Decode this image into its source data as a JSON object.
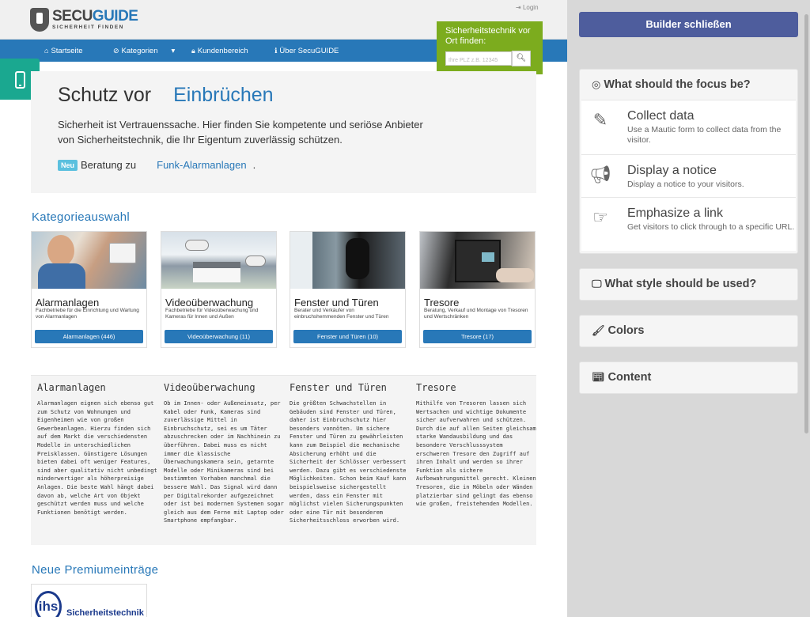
{
  "site": {
    "logo_main_1": "SECU",
    "logo_main_2": "GUIDE",
    "logo_sub": "SICHERHEIT FINDEN",
    "login": "Login",
    "nav": [
      "Startseite",
      "Kategorien",
      "Kundenbereich",
      "Über SecuGUIDE"
    ],
    "finder": {
      "title": "Sicherheitstechnik vor Ort finden:",
      "placeholder": "Ihre PLZ z.B. 12345"
    },
    "hero": {
      "title_1": "Schutz vor",
      "title_2": "Einbrüchen",
      "text": "Sicherheit ist Vertrauenssache. Hier finden Sie kompetente und seriöse Anbieter von Sicherheitstechnik, die Ihr Eigentum zuverlässig schützen.",
      "badge": "Neu",
      "news_prefix": "Beratung zu",
      "news_link": "Funk-Alarmanlagen",
      "news_suffix": "."
    },
    "category_heading": "Kategorieauswahl",
    "cards": [
      {
        "title": "Alarmanlagen",
        "desc": "Fachbetriebe für die Einrichtung und Wartung von Alarmanlagen",
        "button": "Alarmanlagen (446)"
      },
      {
        "title": "Videoüberwachung",
        "desc": "Fachbetriebe für Videoüberwachung und Kameras für Innen und Außen",
        "button": "Videoüberwachung (11)"
      },
      {
        "title": "Fenster und Türen",
        "desc": "Berater und Verkäufer von einbruchshemmenden Fenster und Türen",
        "button": "Fenster und Türen (10)"
      },
      {
        "title": "Tresore",
        "desc": "Beratung, Verkauf und Montage von Tresoren und Wertschränken",
        "button": "Tresore (17)"
      }
    ],
    "text_columns": [
      {
        "title": "Alarmanlagen",
        "body": "Alarmanlagen eignen sich ebenso gut zum Schutz von Wohnungen und Eigenheimen wie von großen Gewerbeanlagen. Hierzu finden sich auf dem Markt die verschiedensten Modelle in unterschiedlichen Preisklassen. Günstigere Lösungen bieten dabei oft weniger Features, sind aber qualitativ nicht unbedingt minderwertiger als höherpreisige Anlagen. Die beste Wahl hängt dabei davon ab, welche Art von Objekt geschützt werden muss und welche Funktionen benötigt werden."
      },
      {
        "title": "Videoüberwachung",
        "body": "Ob im Innen- oder Außeneinsatz, per Kabel oder Funk, Kameras sind zuverlässige Mittel in Einbruchschutz, sei es um Täter abzuschrecken oder im Nachhinein zu überführen. Dabei muss es nicht immer die klassische Überwachungskamera sein, getarnte Modelle oder Minikameras sind bei bestimmten Vorhaben manchmal die bessere Wahl. Das Signal wird dann per Digitalrekorder aufgezeichnet oder ist bei modernen Systemen sogar gleich aus dem Ferne mit Laptop oder Smartphone empfangbar."
      },
      {
        "title": "Fenster und Türen",
        "body": "Die größten Schwachstellen in Gebäuden sind Fenster und Türen, daher ist Einbruchschutz hier besonders vonnöten. Um sichere Fenster und Türen zu gewährleisten kann zum Beispiel die mechanische Absicherung erhöht und die Sicherheit der Schlösser verbessert werden. Dazu gibt es verschiedenste Möglichkeiten. Schon beim Kauf kann beispielsweise sichergestellt werden, dass ein Fenster mit möglichst vielen Sicherungspunkten oder eine Tür mit besonderem Sicherheitsschloss erworben wird."
      },
      {
        "title": "Tresore",
        "body": "Mithilfe von Tresoren lassen sich Wertsachen und wichtige Dokumente sicher aufverwahren und schützen. Durch die auf allen Seiten gleichsam starke Wandausbildung und das besondere Verschlusssystem erschweren Tresore den Zugriff auf ihren Inhalt und werden so ihrer Funktion als sichere Aufbewahrungsmittel gerecht. Kleinen Tresoren, die in Möbeln oder Wänden platzierbar sind gelingt das ebenso wie großen, freistehenden Modellen."
      }
    ],
    "premium_heading": "Neue Premiumeinträge",
    "premium_logo_text": "ihs",
    "premium_name": "Sicherheitstechnik"
  },
  "builder": {
    "close_button": "Builder schließen",
    "focus": {
      "title": "What should the focus be?",
      "items": [
        {
          "label": "Collect data",
          "desc": "Use a Mautic form to collect data from the visitor."
        },
        {
          "label": "Display a notice",
          "desc": "Display a notice to your visitors."
        },
        {
          "label": "Emphasize a link",
          "desc": "Get visitors to click through to a specific URL."
        }
      ]
    },
    "style_title": "What style should be used?",
    "colors_title": "Colors",
    "content_title": "Content"
  },
  "colors": {
    "primary": "#2878b8",
    "finder": "#7cac1e",
    "phone_tab": "#1aa890",
    "builder_button": "#4e5d9d"
  }
}
